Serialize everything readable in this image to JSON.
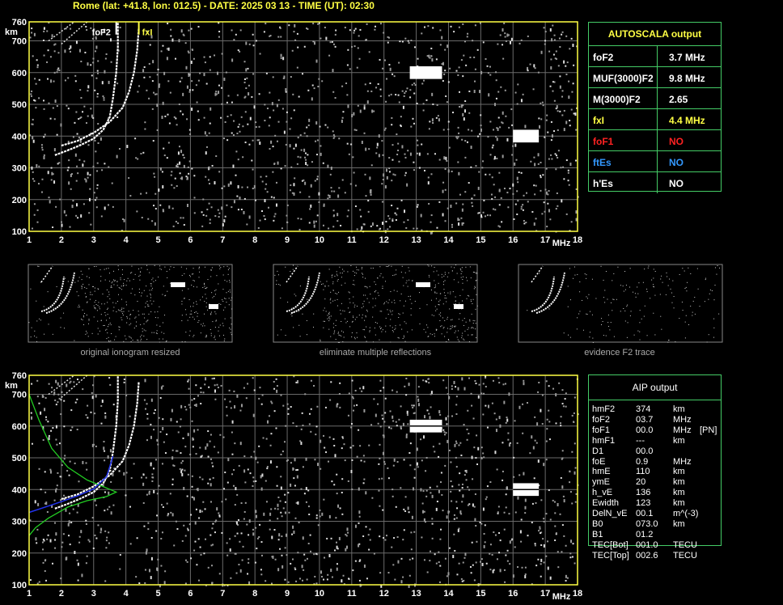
{
  "title": "Rome (lat: +41.8, lon: 012.5) - DATE: 2025 03 13 - TIME (UT): 02:30",
  "chart_data": [
    {
      "type": "scatter",
      "name": "top-ionogram",
      "xlabel": "MHz",
      "ylabel": "km",
      "xlim": [
        1,
        18
      ],
      "ylim": [
        100,
        760
      ],
      "x_ticks": [
        "1",
        "2",
        "3",
        "4",
        "5",
        "6",
        "7",
        "8",
        "9",
        "10",
        "11",
        "12",
        "13",
        "14",
        "15",
        "16",
        "17",
        "18"
      ],
      "y_ticks": [
        "100",
        "200",
        "300",
        "400",
        "500",
        "600",
        "700",
        "760"
      ],
      "grid": true,
      "annotations": [
        {
          "label": "foF2",
          "x": 3.7
        },
        {
          "label": "fxI",
          "x": 4.4
        }
      ],
      "traces": {
        "o_trace": [
          [
            1.8,
            340
          ],
          [
            2.2,
            355
          ],
          [
            2.6,
            372
          ],
          [
            3.0,
            392
          ],
          [
            3.3,
            420
          ],
          [
            3.5,
            460
          ],
          [
            3.6,
            520
          ],
          [
            3.7,
            600
          ],
          [
            3.75,
            680
          ],
          [
            3.75,
            760
          ]
        ],
        "x_trace": [
          [
            2.0,
            370
          ],
          [
            2.5,
            385
          ],
          [
            3.0,
            410
          ],
          [
            3.5,
            445
          ],
          [
            3.9,
            490
          ],
          [
            4.1,
            540
          ],
          [
            4.25,
            600
          ],
          [
            4.35,
            670
          ],
          [
            4.4,
            740
          ]
        ]
      }
    },
    {
      "type": "scatter",
      "name": "bottom-ionogram",
      "xlabel": "MHz",
      "ylabel": "km",
      "xlim": [
        1,
        18
      ],
      "ylim": [
        100,
        760
      ],
      "x_ticks": [
        "1",
        "2",
        "3",
        "4",
        "5",
        "6",
        "7",
        "8",
        "9",
        "10",
        "11",
        "12",
        "13",
        "14",
        "15",
        "16",
        "17",
        "18"
      ],
      "y_ticks": [
        "100",
        "200",
        "300",
        "400",
        "500",
        "600",
        "700",
        "760"
      ],
      "grid": true,
      "profile_green": [
        [
          1.0,
          700
        ],
        [
          1.3,
          620
        ],
        [
          1.7,
          530
        ],
        [
          2.2,
          470
        ],
        [
          2.8,
          430
        ],
        [
          3.4,
          405
        ],
        [
          3.7,
          392
        ],
        [
          3.4,
          378
        ],
        [
          2.8,
          365
        ],
        [
          2.2,
          345
        ],
        [
          1.6,
          310
        ],
        [
          1.2,
          280
        ],
        [
          1.0,
          255
        ]
      ],
      "profile_blue": [
        [
          1.0,
          328
        ],
        [
          1.5,
          345
        ],
        [
          2.0,
          362
        ],
        [
          2.5,
          380
        ],
        [
          3.0,
          402
        ],
        [
          3.4,
          440
        ],
        [
          3.6,
          505
        ]
      ]
    }
  ],
  "autoscala": {
    "header": "AUTOSCALA output",
    "rows": [
      {
        "key": "foF2",
        "value": "3.7 MHz",
        "color": "#ffffff"
      },
      {
        "key": "MUF(3000)F2",
        "value": "9.8 MHz",
        "color": "#ffffff"
      },
      {
        "key": "M(3000)F2",
        "value": "2.65",
        "color": "#ffffff"
      },
      {
        "key": "fxI",
        "value": "4.4 MHz",
        "color": "#ffff44"
      },
      {
        "key": "foF1",
        "value": "NO",
        "color": "#ff2222"
      },
      {
        "key": "ftEs",
        "value": "NO",
        "color": "#3399ff"
      },
      {
        "key": "h'Es",
        "value": "NO",
        "color": "#ffffff"
      }
    ]
  },
  "thumbnails": [
    {
      "caption": "original ionogram resized"
    },
    {
      "caption": "eliminate multiple reflections"
    },
    {
      "caption": "evidence F2 trace"
    }
  ],
  "aip": {
    "header": "AIP output",
    "rows": [
      {
        "key": "hmF2",
        "value": "374",
        "unit": "km",
        "extra": ""
      },
      {
        "key": "foF2",
        "value": "03.7",
        "unit": "MHz",
        "extra": ""
      },
      {
        "key": "foF1",
        "value": "00.0",
        "unit": "MHz",
        "extra": "[PN]"
      },
      {
        "key": "hmF1",
        "value": "---",
        "unit": "km",
        "extra": ""
      },
      {
        "key": "D1",
        "value": "00.0",
        "unit": "",
        "extra": ""
      },
      {
        "key": "foE",
        "value": "0.9",
        "unit": "MHz",
        "extra": ""
      },
      {
        "key": "hmE",
        "value": "110",
        "unit": "km",
        "extra": ""
      },
      {
        "key": "ymE",
        "value": "20",
        "unit": "km",
        "extra": ""
      },
      {
        "key": "h_vE",
        "value": "136",
        "unit": "km",
        "extra": ""
      },
      {
        "key": "Ewidth",
        "value": "123",
        "unit": "km",
        "extra": ""
      },
      {
        "key": "DelN_vE",
        "value": "00.1",
        "unit": "m^(-3)",
        "extra": ""
      },
      {
        "key": "B0",
        "value": "073.0",
        "unit": "km",
        "extra": ""
      },
      {
        "key": "B1",
        "value": "01.2",
        "unit": "",
        "extra": ""
      },
      {
        "key": "TEC[Bot]",
        "value": "001.0",
        "unit": "TECU",
        "extra": ""
      },
      {
        "key": "TEC[Top]",
        "value": "002.6",
        "unit": "TECU",
        "extra": ""
      }
    ]
  },
  "colors": {
    "axis": "#ffff44",
    "grid": "#6a6a6a",
    "table_border": "#44cc66",
    "trace": "#ffffff",
    "profile_green": "#22cc22",
    "profile_blue": "#2233ee"
  }
}
